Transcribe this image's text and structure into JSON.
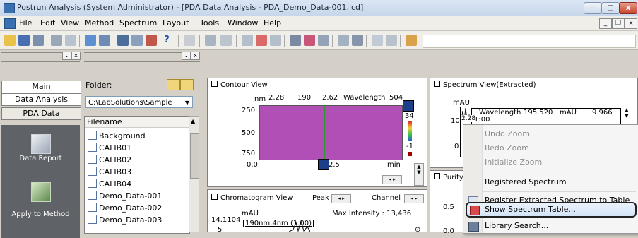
{
  "window": {
    "title": "Postrun Analysis (System Administrator) - [PDA Data Analysis - PDA_Demo_Data-001.lcd]",
    "min_label": "–",
    "max_label": "□",
    "close_label": "x"
  },
  "menubar": {
    "items": [
      "File",
      "Edit",
      "View",
      "Method",
      "Spectrum",
      "Layout",
      "Tools",
      "Window",
      "Help"
    ],
    "mdi_min": "_",
    "mdi_restore": "❐",
    "mdi_close": "x"
  },
  "toolbar": {
    "help_label": "?"
  },
  "sidebar": {
    "tabs": [
      "Main",
      "Data Analysis",
      "PDA Data"
    ],
    "items": [
      {
        "label": "Data Report",
        "icon": "report-icon"
      },
      {
        "label": "Apply to Method",
        "icon": "apply-method-icon"
      }
    ]
  },
  "folder": {
    "label": "Folder:",
    "path": "C:\\LabSolutions\\Sample",
    "column_header": "Filename",
    "files": [
      "Background",
      "CALIB01",
      "CALIB02",
      "CALIB03",
      "CALIB04",
      "Demo_Data-001",
      "Demo_Data-002",
      "Demo_Data-003"
    ]
  },
  "contour": {
    "title": "Contour View",
    "header_unit": "nm",
    "header_v1": "2.28",
    "header_v2": "190",
    "header_v3": "2.62",
    "header_label": "Wavelength",
    "header_v4": "504",
    "yticks": [
      "250",
      "500",
      "750"
    ],
    "xticks": [
      "0.0",
      "2.5",
      "min"
    ],
    "scale_top": "34",
    "scale_bottom": "-1",
    "plot_color": "#b04fb5"
  },
  "spectrum": {
    "title": "Spectrum View(Extracted)",
    "unit": "mAU",
    "readout_label": "Wavelength",
    "readout_wl": "195.520",
    "readout_unit": "mAU",
    "readout_val": "9.966",
    "cursor_top": "2.28",
    "cursor_line": "1:00",
    "yticks": [
      "10",
      "0"
    ]
  },
  "chromatogram": {
    "title": "Chromatogram View",
    "peak_label": "Peak",
    "channel_label": "Channel",
    "unit": "mAU",
    "max_label": "Max Intensity : 13,436",
    "cursor_val": "14.1104",
    "trace_label": "190nm,4nm (1.00)",
    "ytick": "5"
  },
  "purity": {
    "title": "Purity",
    "yticks": [
      "0.5",
      "0.0"
    ]
  },
  "context_menu": {
    "undo_zoom": "Undo Zoom",
    "redo_zoom": "Redo Zoom",
    "initialize_zoom": "Initialize Zoom",
    "registered_spectrum": "Registered Spectrum",
    "register_extracted": "Register Extracted Spectrum to Table",
    "show_table": "Show Spectrum Table...",
    "library_search": "Library Search..."
  }
}
